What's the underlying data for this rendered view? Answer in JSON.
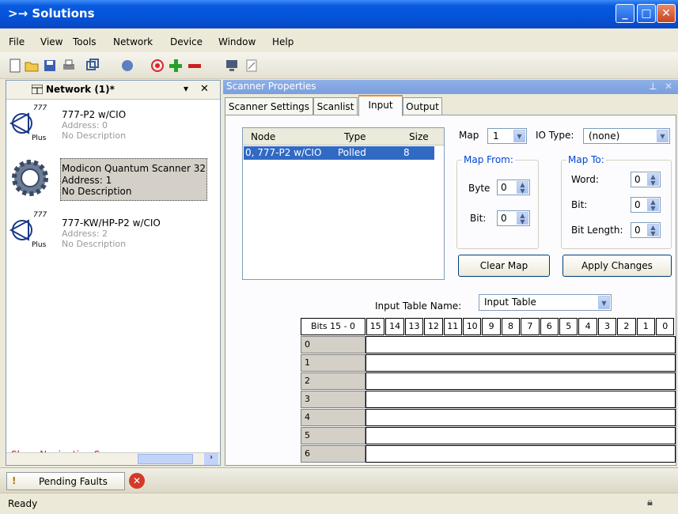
{
  "window": {
    "title": "Solutions"
  },
  "menu": [
    "File",
    "View",
    "Tools",
    "Network",
    "Device",
    "Window",
    "Help"
  ],
  "network_panel": {
    "title": "Network (1)*",
    "nodes": [
      {
        "badge": "777",
        "sub_badge": "Plus",
        "name": "777-P2 w/CIO",
        "address": "Address: 0",
        "description": "No Description"
      },
      {
        "name": "Modicon Quantum Scanner 32",
        "address": "Address: 1",
        "description": "No Description"
      },
      {
        "badge": "777",
        "sub_badge": "Plus",
        "name": "777-KW/HP-P2 w/CIO",
        "address": "Address: 2",
        "description": "No Description"
      }
    ],
    "nav_link": "Show Navigation Screen"
  },
  "scanner": {
    "title": "Scanner Properties",
    "tabs": [
      "Scanner Settings",
      "Scanlist",
      "Input",
      "Output"
    ],
    "active_tab": "Input",
    "list_headers": [
      "Node",
      "Type",
      "Size"
    ],
    "list_row": [
      "0, 777-P2 w/CIO",
      "Polled",
      "8"
    ],
    "map_label": "Map",
    "map_value": "1",
    "io_type_label": "IO Type:",
    "io_type_value": "(none)",
    "map_from_label": "Map From:",
    "byte_label": "Byte",
    "byte_value": "0",
    "bit_label": "Bit:",
    "bit_value": "0",
    "map_to_label": "Map To:",
    "word_label": "Word:",
    "word_value": "0",
    "to_bit_label": "Bit:",
    "to_bit_value": "0",
    "bit_length_label": "Bit Length:",
    "bit_length_value": "0",
    "clear_map": "Clear Map",
    "apply_changes": "Apply Changes",
    "table_name_label": "Input Table Name:",
    "table_name_value": "Input Table",
    "bits_header": "Bits 15 - 0",
    "bit_columns": [
      "15",
      "14",
      "13",
      "12",
      "11",
      "10",
      "9",
      "8",
      "7",
      "6",
      "5",
      "4",
      "3",
      "2",
      "1",
      "0"
    ],
    "rows": [
      "0",
      "1",
      "2",
      "3",
      "4",
      "5",
      "6"
    ]
  },
  "bottom": {
    "pending_faults": "Pending Faults",
    "status": "Ready"
  }
}
